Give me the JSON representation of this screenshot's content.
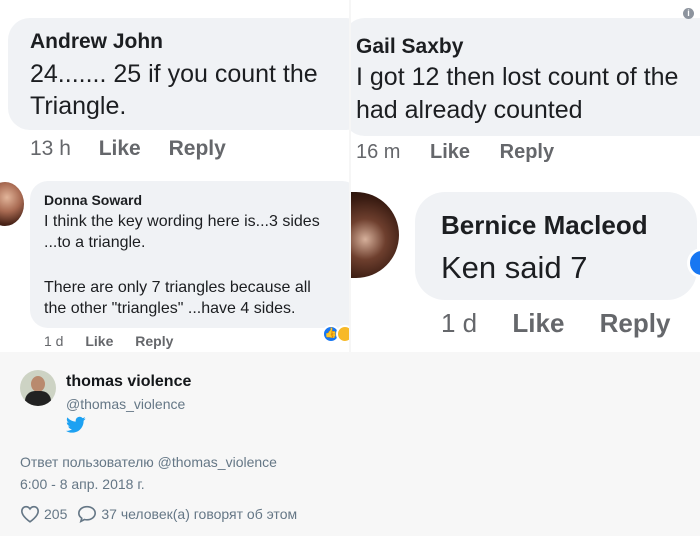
{
  "comments": [
    {
      "name": "Andrew John",
      "lines": [
        "24....... 25 if you count the",
        "Triangle."
      ],
      "time": "13 h",
      "like": "Like",
      "reply": "Reply"
    },
    {
      "name": "Gail Saxby",
      "lines": [
        "I got 12 then lost count of the",
        "had already counted"
      ],
      "time": "16 m",
      "like": "Like",
      "reply": "Reply",
      "info_icon": "info-icon"
    },
    {
      "name": "Donna Soward",
      "lines": [
        "I think the key wording here is...3 sides",
        "...to a triangle.",
        "There are only 7 triangles because all",
        "the other \"triangles\" ...have 4 sides."
      ],
      "time": "1 d",
      "like": "Like",
      "reply": "Reply",
      "reactions": [
        "like-reaction-icon",
        "haha-reaction-icon"
      ]
    },
    {
      "name": "Bernice Macleod",
      "lines": [
        "Ken said 7"
      ],
      "time": "1 d",
      "like": "Like",
      "reply": "Reply",
      "reactions": [
        "like-reaction-icon"
      ]
    }
  ],
  "tweet": {
    "name": "thomas violence",
    "handle": "@thomas_violence",
    "reply_to": "Ответ пользователю @thomas_violence",
    "date": "6:00 - 8 апр. 2018 г.",
    "likes": "205",
    "talking": "37 человек(а) говорят об этом",
    "icons": [
      "twitter-bird-icon",
      "heart-icon",
      "comment-icon"
    ]
  },
  "colors": {
    "bubble": "#f0f2f5",
    "fb_meta": "#65676b",
    "twitter_blue": "#1da1f2",
    "tweet_bg": "#f7f7f7",
    "tweet_meta": "#657786"
  }
}
